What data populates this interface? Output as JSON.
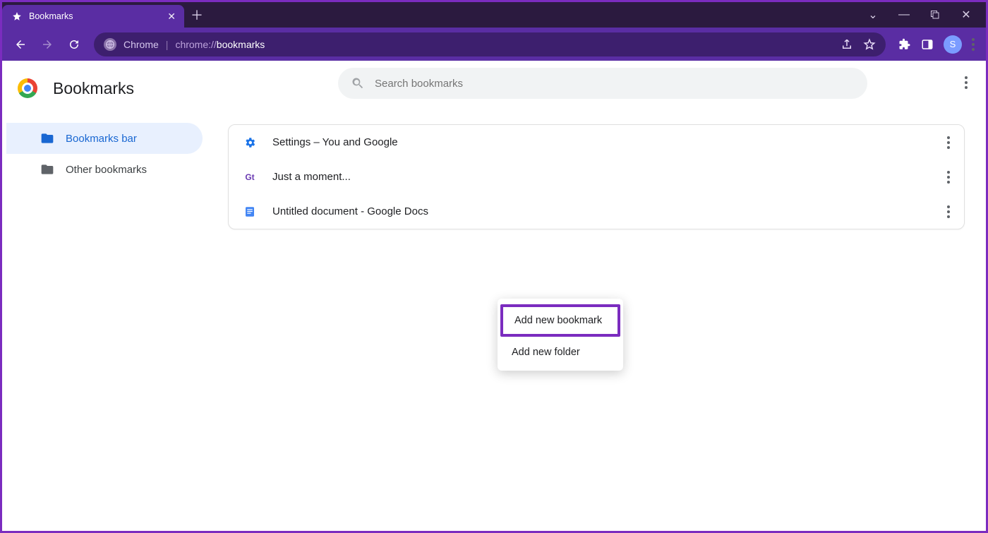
{
  "window": {
    "tab_title": "Bookmarks",
    "controls": {
      "chevron": "⌄",
      "min": "—",
      "max": "▢",
      "close": "✕"
    }
  },
  "toolbar": {
    "app_name": "Chrome",
    "url_prefix": "chrome://",
    "url_path": "bookmarks",
    "avatar_initial": "S"
  },
  "page": {
    "title": "Bookmarks",
    "search_placeholder": "Search bookmarks"
  },
  "sidebar": {
    "items": [
      {
        "label": "Bookmarks bar",
        "active": true
      },
      {
        "label": "Other bookmarks",
        "active": false
      }
    ]
  },
  "bookmarks": [
    {
      "title": "Settings – You and Google",
      "icon": "gear"
    },
    {
      "title": "Just a moment...",
      "icon": "gt"
    },
    {
      "title": "Untitled document - Google Docs",
      "icon": "docs"
    }
  ],
  "context_menu": {
    "items": [
      {
        "label": "Add new bookmark",
        "highlighted": true
      },
      {
        "label": "Add new folder",
        "highlighted": false
      }
    ]
  }
}
